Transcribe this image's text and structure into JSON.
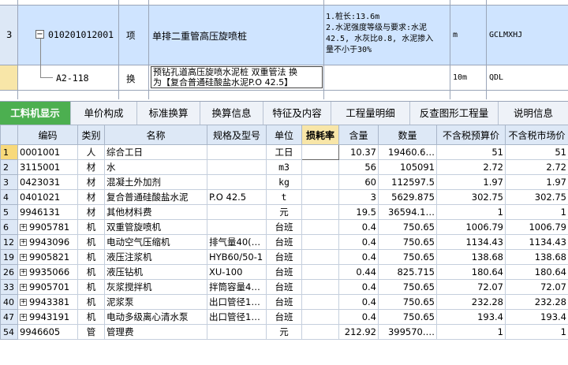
{
  "top": {
    "rows": [
      {
        "idx": "3",
        "code": "010201012001",
        "type": "项",
        "name": "单排二重管高压旋喷桩",
        "feature_lines": [
          "1.桩长:13.6m",
          "2.水泥强度等级与要求:水泥",
          "42.5, 水灰比0.8, 水泥掺入",
          "量不小于30%"
        ],
        "unit": "m",
        "spec": "GCLMXHJ"
      },
      {
        "idx": "",
        "code": "A2-118",
        "type": "换",
        "name_lines": [
          "预钻孔道高压旋喷水泥桩 双重管法  换",
          "为【复合普通硅酸盐水泥P.O 42.5】"
        ],
        "unit": "10m",
        "spec": "QDL"
      }
    ]
  },
  "tabs": [
    {
      "label": "工料机显示",
      "active": true
    },
    {
      "label": "单价构成",
      "active": false
    },
    {
      "label": "标准换算",
      "active": false
    },
    {
      "label": "换算信息",
      "active": false
    },
    {
      "label": "特征及内容",
      "active": false
    },
    {
      "label": "工程量明细",
      "active": false
    },
    {
      "label": "反查图形工程量",
      "active": false
    },
    {
      "label": "说明信息",
      "active": false
    }
  ],
  "grid": {
    "headers": [
      "编码",
      "类别",
      "名称",
      "规格及型号",
      "单位",
      "损耗率",
      "含量",
      "数量",
      "不含税预算价",
      "不含税市场价"
    ],
    "rows": [
      {
        "idx": "1",
        "exp": false,
        "code": "0001001",
        "cat": "人",
        "name": "综合工日",
        "spec": "",
        "unit": "工日",
        "loss": "",
        "qty_per": "10.37",
        "qty": "19460.6…",
        "budget": "51",
        "market": "51"
      },
      {
        "idx": "2",
        "exp": false,
        "code": "3115001",
        "cat": "材",
        "name": "水",
        "spec": "",
        "unit": "m3",
        "loss": "",
        "qty_per": "56",
        "qty": "105091",
        "budget": "2.72",
        "market": "2.72"
      },
      {
        "idx": "3",
        "exp": false,
        "code": "0423031",
        "cat": "材",
        "name": "混凝土外加剂",
        "spec": "",
        "unit": "kg",
        "loss": "",
        "qty_per": "60",
        "qty": "112597.5",
        "budget": "1.97",
        "market": "1.97"
      },
      {
        "idx": "4",
        "exp": false,
        "code": "0401021",
        "cat": "材",
        "name": "复合普通硅酸盐水泥",
        "spec": "P.O 42.5",
        "unit": "t",
        "loss": "",
        "qty_per": "3",
        "qty": "5629.875",
        "budget": "302.75",
        "market": "302.75"
      },
      {
        "idx": "5",
        "exp": false,
        "code": "9946131",
        "cat": "材",
        "name": "其他材料费",
        "spec": "",
        "unit": "元",
        "loss": "",
        "qty_per": "19.5",
        "qty": "36594.1…",
        "budget": "1",
        "market": "1"
      },
      {
        "idx": "6",
        "exp": true,
        "code": "9905781",
        "cat": "机",
        "name": "双重管旋喷机",
        "spec": "",
        "unit": "台班",
        "loss": "",
        "qty_per": "0.4",
        "qty": "750.65",
        "budget": "1006.79",
        "market": "1006.79"
      },
      {
        "idx": "12",
        "exp": true,
        "code": "9943096",
        "cat": "机",
        "name": "电动空气压缩机",
        "spec": "排气量40(…",
        "unit": "台班",
        "loss": "",
        "qty_per": "0.4",
        "qty": "750.65",
        "budget": "1134.43",
        "market": "1134.43"
      },
      {
        "idx": "19",
        "exp": true,
        "code": "9905821",
        "cat": "机",
        "name": "液压注浆机",
        "spec": "HYB60/50-1",
        "unit": "台班",
        "loss": "",
        "qty_per": "0.4",
        "qty": "750.65",
        "budget": "138.68",
        "market": "138.68"
      },
      {
        "idx": "26",
        "exp": true,
        "code": "9935066",
        "cat": "机",
        "name": "液压钻机",
        "spec": "XU-100",
        "unit": "台班",
        "loss": "",
        "qty_per": "0.44",
        "qty": "825.715",
        "budget": "180.64",
        "market": "180.64"
      },
      {
        "idx": "33",
        "exp": true,
        "code": "9905701",
        "cat": "机",
        "name": "灰浆搅拌机",
        "spec": "拌筒容量4…",
        "unit": "台班",
        "loss": "",
        "qty_per": "0.4",
        "qty": "750.65",
        "budget": "72.07",
        "market": "72.07"
      },
      {
        "idx": "40",
        "exp": true,
        "code": "9943381",
        "cat": "机",
        "name": "泥浆泵",
        "spec": "出口管径1…",
        "unit": "台班",
        "loss": "",
        "qty_per": "0.4",
        "qty": "750.65",
        "budget": "232.28",
        "market": "232.28"
      },
      {
        "idx": "47",
        "exp": true,
        "code": "9943191",
        "cat": "机",
        "name": "电动多级离心清水泵",
        "spec": "出口管径1…",
        "unit": "台班",
        "loss": "",
        "qty_per": "0.4",
        "qty": "750.65",
        "budget": "193.4",
        "market": "193.4"
      },
      {
        "idx": "54",
        "exp": false,
        "code": "9946605",
        "cat": "管",
        "name": "管理费",
        "spec": "",
        "unit": "元",
        "loss": "",
        "qty_per": "212.92",
        "qty": "399570.…",
        "budget": "1",
        "market": "1"
      }
    ]
  }
}
